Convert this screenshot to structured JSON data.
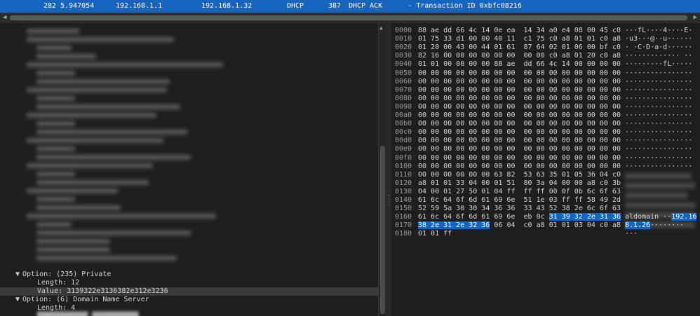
{
  "packet_row": {
    "no": "282",
    "time": "5.947054",
    "src": "192.168.1.1",
    "dst": "192.168.1.32",
    "proto": "DHCP",
    "len": "387",
    "info": "DHCP ACK      - Transaction ID 0xbfc08216"
  },
  "tree": {
    "opt235": "Option: (235) Private",
    "opt235_len": "Length: 12",
    "opt235_val": "Value: 3139322e3136382e312e3236",
    "opt6": "Option: (6) Domain Name Server",
    "opt6_len": "Length: 4"
  },
  "hex": [
    {
      "off": "0000",
      "pre": "88 ae dd 66 4c 14 0e ea  14 34 a0 e4 08 00 45 c0",
      "hl": "",
      "post": "",
      "a_pre": "···fL····4····E·",
      "a_hl": "",
      "a_post": ""
    },
    {
      "off": "0010",
      "pre": "01 75 33 d1 00 00 40 11  c1 75 c0 a8 01 01 c0 a8",
      "hl": "",
      "post": "",
      "a_pre": "·u3···@··u······",
      "a_hl": "",
      "a_post": ""
    },
    {
      "off": "0020",
      "pre": "01 20 00 43 00 44 01 61  87 64 02 01 06 00 bf c0",
      "hl": "",
      "post": "",
      "a_pre": "· ·C·D·a·d······",
      "a_hl": "",
      "a_post": ""
    },
    {
      "off": "0030",
      "pre": "82 16 00 00 00 00 00 00  00 00 c0 a8 01 20 c0 a8",
      "hl": "",
      "post": "",
      "a_pre": "············· ··",
      "a_hl": "",
      "a_post": ""
    },
    {
      "off": "0040",
      "pre": "01 01 00 00 00 00 88 ae  dd 66 4c 14 00 00 00 00",
      "hl": "",
      "post": "",
      "a_pre": "·········fL·····",
      "a_hl": "",
      "a_post": ""
    },
    {
      "off": "0050",
      "pre": "00 00 00 00 00 00 00 00  00 00 00 00 00 00 00 00",
      "hl": "",
      "post": "",
      "a_pre": "················",
      "a_hl": "",
      "a_post": ""
    },
    {
      "off": "0060",
      "pre": "00 00 00 00 00 00 00 00  00 00 00 00 00 00 00 00",
      "hl": "",
      "post": "",
      "a_pre": "················",
      "a_hl": "",
      "a_post": ""
    },
    {
      "off": "0070",
      "pre": "00 00 00 00 00 00 00 00  00 00 00 00 00 00 00 00",
      "hl": "",
      "post": "",
      "a_pre": "················",
      "a_hl": "",
      "a_post": ""
    },
    {
      "off": "0080",
      "pre": "00 00 00 00 00 00 00 00  00 00 00 00 00 00 00 00",
      "hl": "",
      "post": "",
      "a_pre": "················",
      "a_hl": "",
      "a_post": ""
    },
    {
      "off": "0090",
      "pre": "00 00 00 00 00 00 00 00  00 00 00 00 00 00 00 00",
      "hl": "",
      "post": "",
      "a_pre": "················",
      "a_hl": "",
      "a_post": ""
    },
    {
      "off": "00a0",
      "pre": "00 00 00 00 00 00 00 00  00 00 00 00 00 00 00 00",
      "hl": "",
      "post": "",
      "a_pre": "················",
      "a_hl": "",
      "a_post": ""
    },
    {
      "off": "00b0",
      "pre": "00 00 00 00 00 00 00 00  00 00 00 00 00 00 00 00",
      "hl": "",
      "post": "",
      "a_pre": "················",
      "a_hl": "",
      "a_post": ""
    },
    {
      "off": "00c0",
      "pre": "00 00 00 00 00 00 00 00  00 00 00 00 00 00 00 00",
      "hl": "",
      "post": "",
      "a_pre": "················",
      "a_hl": "",
      "a_post": ""
    },
    {
      "off": "00d0",
      "pre": "00 00 00 00 00 00 00 00  00 00 00 00 00 00 00 00",
      "hl": "",
      "post": "",
      "a_pre": "················",
      "a_hl": "",
      "a_post": ""
    },
    {
      "off": "00e0",
      "pre": "00 00 00 00 00 00 00 00  00 00 00 00 00 00 00 00",
      "hl": "",
      "post": "",
      "a_pre": "················",
      "a_hl": "",
      "a_post": ""
    },
    {
      "off": "00f0",
      "pre": "00 00 00 00 00 00 00 00  00 00 00 00 00 00 00 00",
      "hl": "",
      "post": "",
      "a_pre": "················",
      "a_hl": "",
      "a_post": ""
    },
    {
      "off": "0100",
      "pre": "00 00 00 00 00 00 00 00  00 00 00 00 00 00 00 00",
      "hl": "",
      "post": "",
      "a_pre": "················",
      "a_hl": "",
      "a_post": ""
    },
    {
      "off": "0110",
      "pre": "00 00 00 00 00 00 63 82  53 63 35 01 05 36 04 c0",
      "hl": "",
      "post": "",
      "a_pre": "",
      "a_hl": "",
      "a_post": ""
    },
    {
      "off": "0120",
      "pre": "a8 01 01 33 04 00 01 51  80 3a 04 00 00 a8 c0 3b",
      "hl": "",
      "post": "",
      "a_pre": "",
      "a_hl": "",
      "a_post": ""
    },
    {
      "off": "0130",
      "pre": "04 00 01 27 50 01 04 ff  ff ff 00 0f 0b 6c 6f 63",
      "hl": "",
      "post": "",
      "a_pre": "",
      "a_hl": "",
      "a_post": ""
    },
    {
      "off": "0140",
      "pre": "61 6c 64 6f 6d 61 69 6e  51 1e 03 ff ff 58 49 2d",
      "hl": "",
      "post": "",
      "a_pre": "",
      "a_hl": "",
      "a_post": ""
    },
    {
      "off": "0150",
      "pre": "52 59 5a 30 30 34 36 36  33 43 52 38 2e 6c 6f 63",
      "hl": "",
      "post": "",
      "a_pre": "",
      "a_hl": "",
      "a_post": ""
    },
    {
      "off": "0160",
      "pre": "61 6c 64 6f 6d 61 69 6e  eb 0c ",
      "hl": "31 39 32 2e 31 36",
      "post": "",
      "a_pre": "aldomain ··",
      "a_hl": "192.16",
      "a_post": ""
    },
    {
      "off": "0170",
      "pre": "",
      "hl": "38 2e 31 2e 32 36",
      "post": " 06 04  c0 a8 01 01 03 04 c0 a8",
      "a_pre": "",
      "a_hl": "8.1.26",
      "a_post": "········"
    },
    {
      "off": "0180",
      "pre": "01 01 ff",
      "hl": "",
      "post": "",
      "a_pre": "···",
      "a_hl": "",
      "a_post": ""
    }
  ]
}
